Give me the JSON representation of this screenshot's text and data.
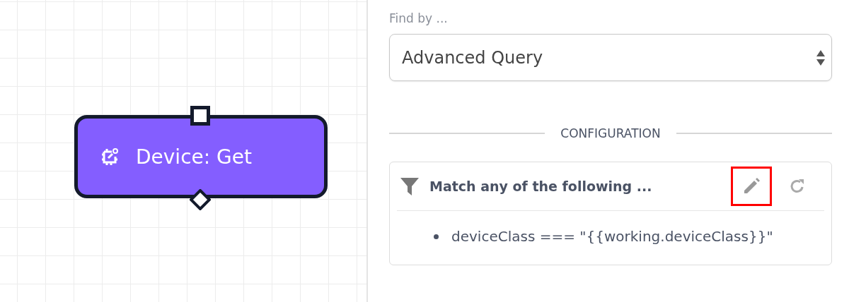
{
  "canvas": {
    "node": {
      "title": "Device: Get"
    }
  },
  "panel": {
    "find_by": {
      "label": "Find by ...",
      "value": "Advanced Query"
    },
    "section_title": "CONFIGURATION",
    "filter": {
      "title": "Match any of the following ...",
      "edit_highlighted": true,
      "conditions": [
        "deviceClass === \"{{working.deviceClass}}\""
      ]
    }
  }
}
